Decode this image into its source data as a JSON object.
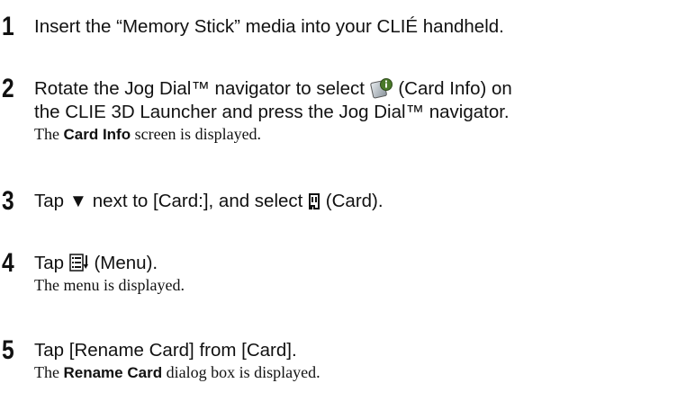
{
  "steps": [
    {
      "number": "1",
      "text": "Insert the “Memory Stick” media into your CLIÉ handheld."
    },
    {
      "number": "2",
      "text_before_icon": "Rotate the Jog Dial™ navigator to select",
      "icon": "card-info-icon",
      "text_after_icon": "(Card Info) on",
      "line2": "the CLIE 3D Launcher and press the Jog Dial™ navigator.",
      "note_pre": "The ",
      "note_bold": "Card Info",
      "note_post": " screen is displayed."
    },
    {
      "number": "3",
      "text_before_arrow": "Tap",
      "arrow": "▼",
      "text_mid": "next to [Card:], and select",
      "icon": "card-icon",
      "text_after_icon": "(Card)."
    },
    {
      "number": "4",
      "text_before_icon": "Tap",
      "icon": "menu-icon",
      "text_after_icon": "(Menu).",
      "note": "The menu is displayed."
    },
    {
      "number": "5",
      "text": "Tap [Rename Card] from [Card].",
      "note_pre": "The ",
      "note_bold": "Rename Card",
      "note_post": " dialog box is displayed."
    }
  ]
}
